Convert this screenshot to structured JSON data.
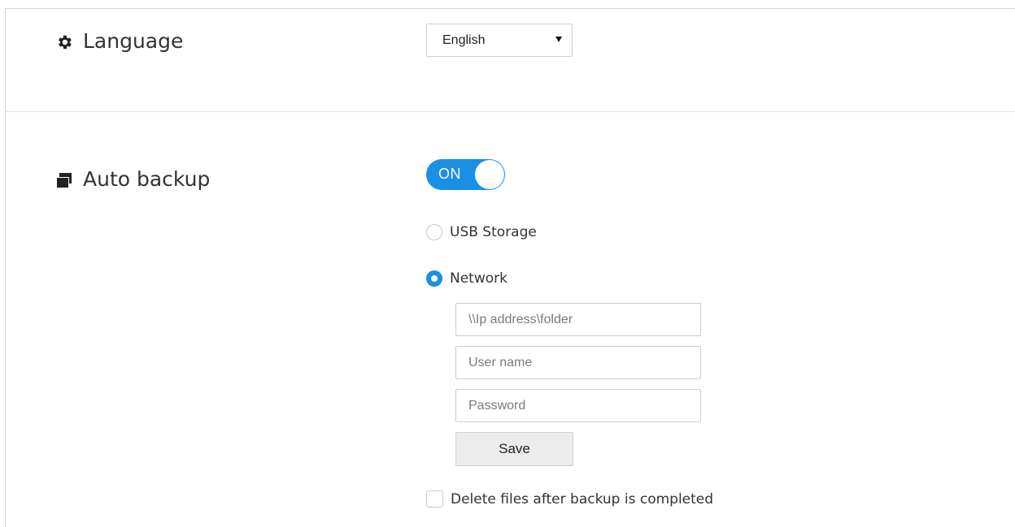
{
  "language": {
    "title": "Language",
    "icon": "gear-icon",
    "selected": "English"
  },
  "backup": {
    "title": "Auto backup",
    "icon": "window-icon",
    "toggle_label": "ON",
    "toggle_state": "on",
    "options": {
      "usb_label": "USB Storage",
      "network_label": "Network",
      "selected": "Network"
    },
    "network": {
      "ip_placeholder": "\\\\Ip address\\folder",
      "user_placeholder": "User name",
      "password_placeholder": "Password",
      "save_label": "Save"
    },
    "delete_label": "Delete files after backup is completed",
    "delete_checked": false
  },
  "colors": {
    "accent": "#1a8fe6"
  }
}
